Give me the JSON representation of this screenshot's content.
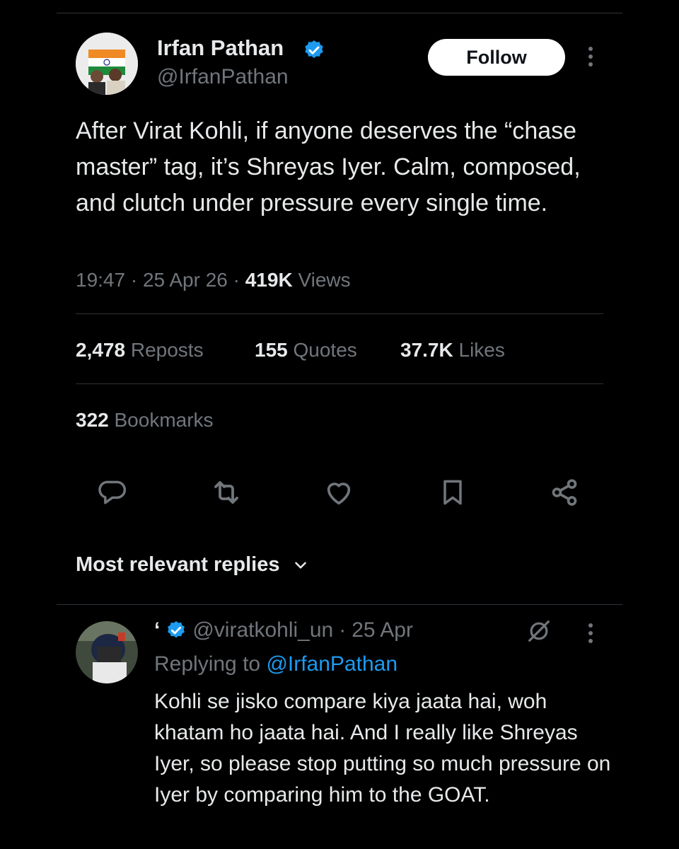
{
  "tweet": {
    "author_name": "Irfan Pathan",
    "author_handle": "@IrfanPathan",
    "follow_label": "Follow",
    "text": "After Virat Kohli, if anyone deserves the “chase master” tag, it’s Shreyas Iyer. Calm, composed, and clutch under pressure every single time.",
    "time": "19:47",
    "date": "25 Apr 26",
    "views_count": "419K",
    "views_label": "Views",
    "sep": "·"
  },
  "stats": {
    "reposts_count": "2,478",
    "reposts_label": "Reposts",
    "quotes_count": "155",
    "quotes_label": "Quotes",
    "likes_count": "37.7K",
    "likes_label": "Likes",
    "bookmarks_count": "322",
    "bookmarks_label": "Bookmarks"
  },
  "actions": [
    "reply-icon",
    "repost-icon",
    "like-icon",
    "bookmark-icon",
    "share-icon"
  ],
  "replies_header": {
    "label": "Most relevant replies"
  },
  "reply": {
    "name": "‘",
    "handle": "@viratkohli_un",
    "date": "25 Apr",
    "replying_prefix": "Replying to",
    "replying_handle": "@IrfanPathan",
    "text": "Kohli se jisko compare kiya jaata hai, woh khatam ho jaata hai. And I really like Shreyas Iyer, so please stop putting so much pressure on Iyer by comparing him to the GOAT."
  },
  "colors": {
    "background": "#000000",
    "text": "#e7e9ea",
    "muted": "#71767b",
    "accent": "#1d9bf0",
    "divider": "#2f3336"
  }
}
